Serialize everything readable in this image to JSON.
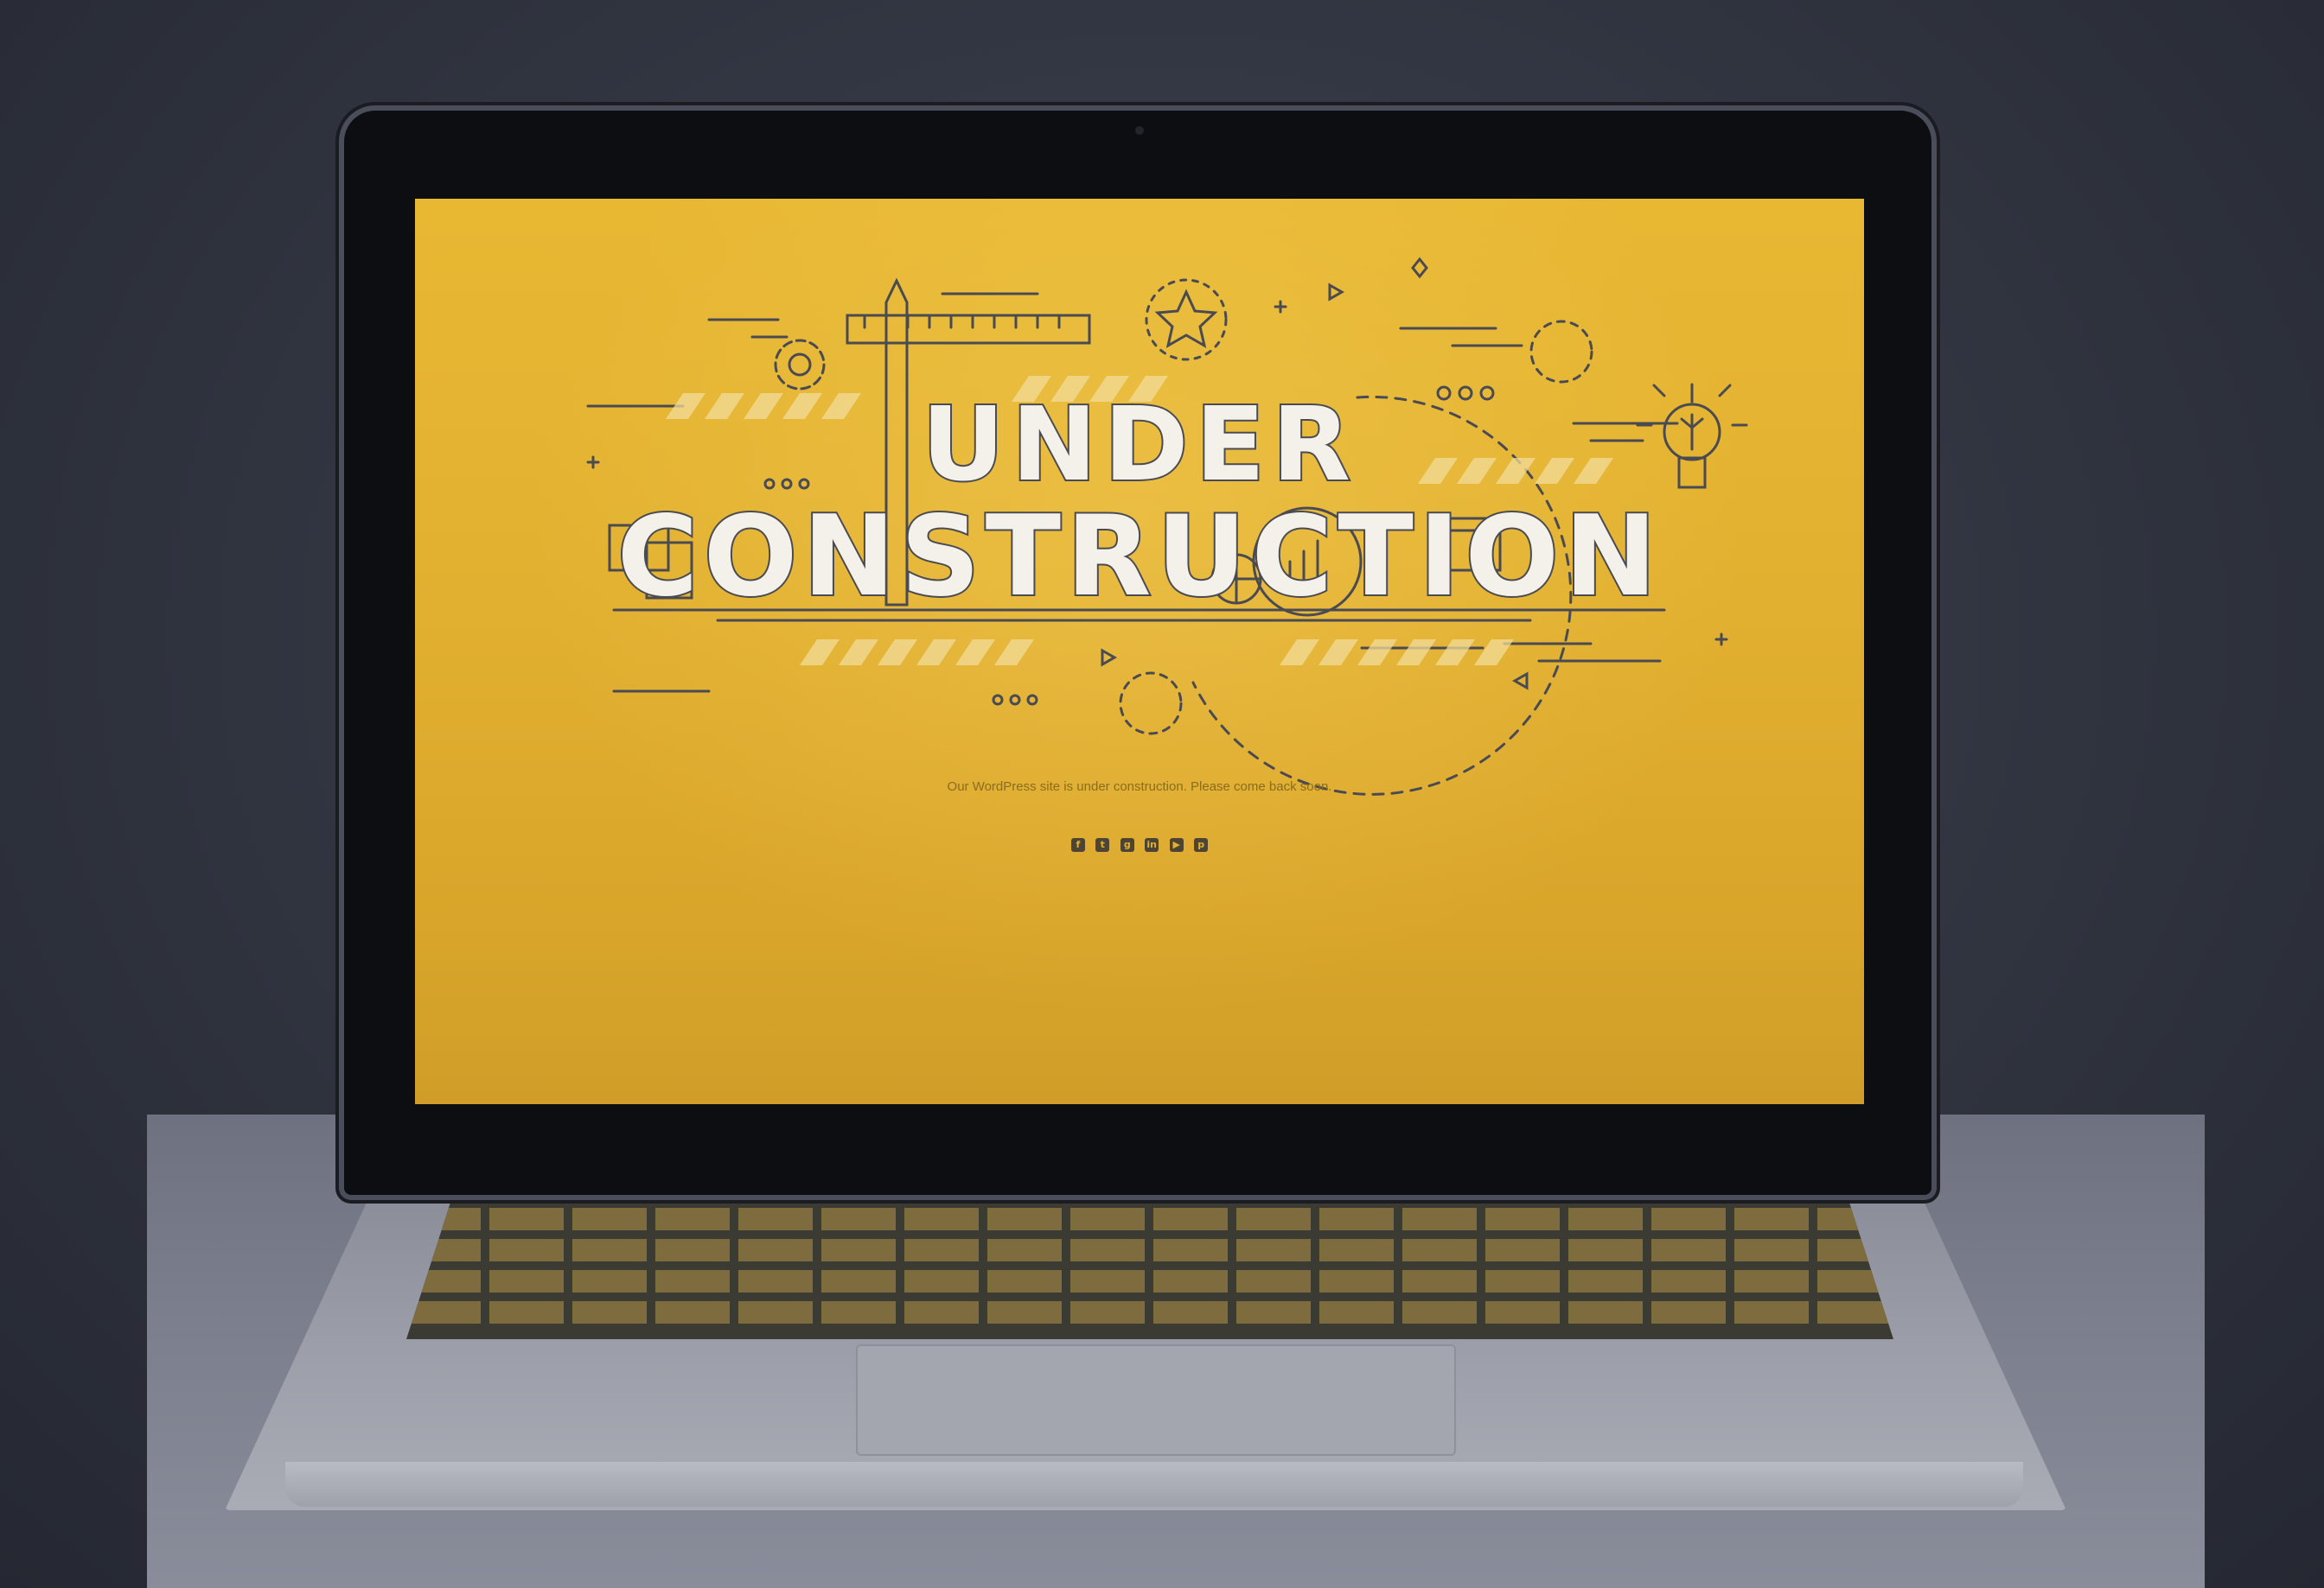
{
  "screen": {
    "headline_line1": "UNDER",
    "headline_line2": "CONSTRUCTION",
    "tagline": "Our WordPress site is under construction. Please come back soon.",
    "social_icons": [
      "facebook-icon",
      "twitter-icon",
      "google-plus-icon",
      "linkedin-icon",
      "youtube-icon",
      "pinterest-icon"
    ],
    "social_glyphs": [
      "f",
      "t",
      "g",
      "in",
      "▶",
      "p"
    ]
  },
  "colors": {
    "screen_yellow": "#e2b030",
    "line_art": "#4a4a52",
    "headline_fill": "#f3f1ea",
    "background": "#2f3340"
  }
}
